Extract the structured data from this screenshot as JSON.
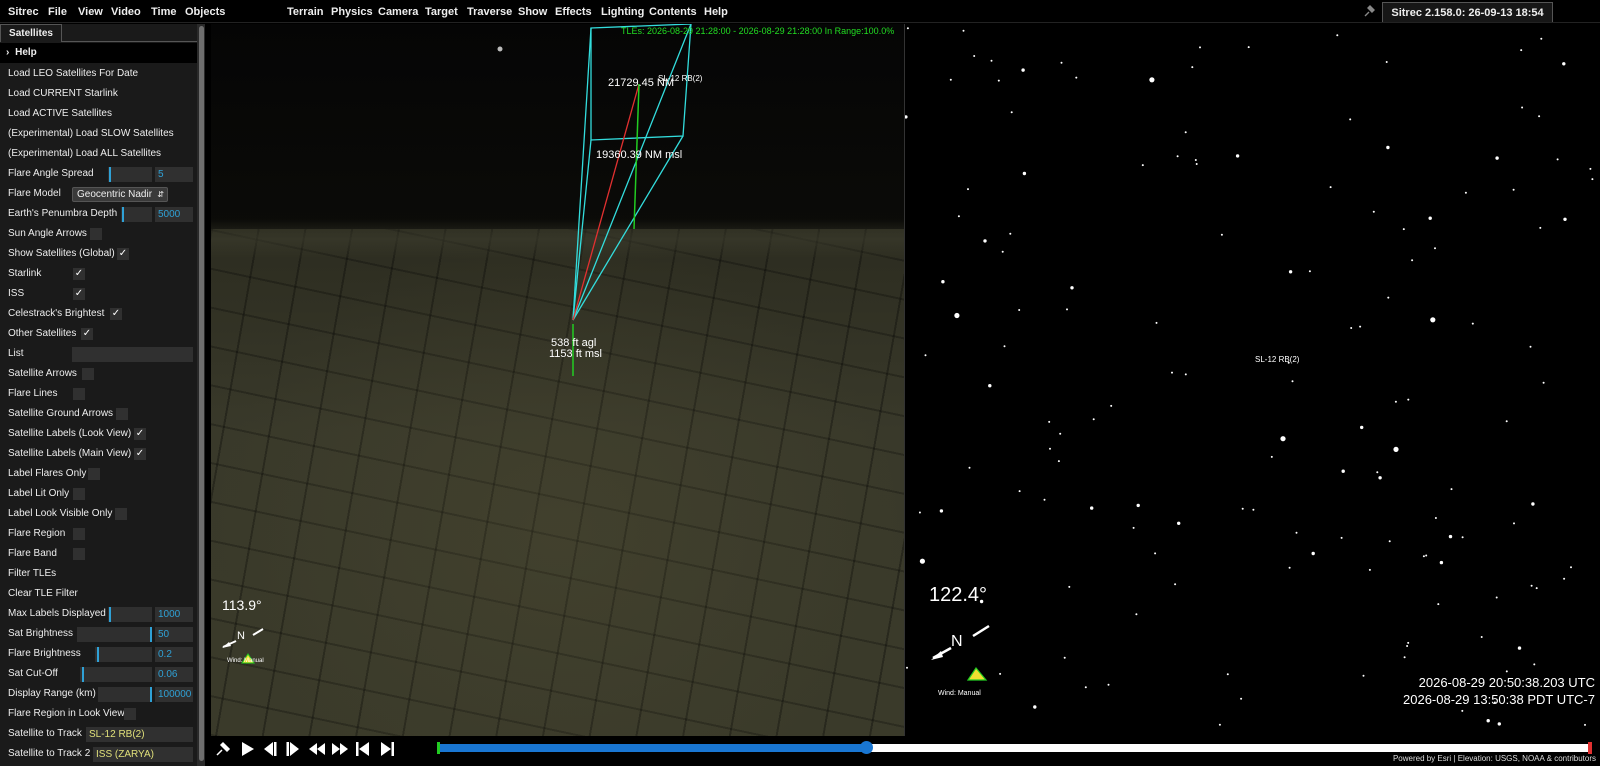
{
  "menubar": {
    "left_items": [
      "Sitrec",
      "File",
      "View",
      "Video",
      "Time",
      "Objects"
    ],
    "right_items": [
      "Terrain",
      "Physics",
      "Camera",
      "Target",
      "Traverse",
      "Show",
      "Effects",
      "Lighting",
      "Contents",
      "Help"
    ],
    "version": "Sitrec 2.158.0: 26-09-13 18:54 UTC"
  },
  "panel": {
    "tab": "Satellites",
    "help": "Help",
    "rows": {
      "load_leo": "Load LEO Satellites For Date",
      "load_starlink": "Load CURRENT Starlink",
      "load_active": "Load ACTIVE Satellites",
      "load_slow": "(Experimental) Load SLOW Satellites",
      "load_all": "(Experimental) Load ALL Satellites",
      "flare_angle_spread": {
        "label": "Flare Angle Spread",
        "value": "5"
      },
      "flare_model": {
        "label": "Flare Model",
        "value": "Geocentric Nadir"
      },
      "penumbra_depth": {
        "label": "Earth's Penumbra Depth",
        "value": "5000"
      },
      "sun_angle_arrows": {
        "label": "Sun Angle Arrows",
        "checked": false
      },
      "show_satellites": {
        "label": "Show Satellites (Global)",
        "checked": true
      },
      "starlink": {
        "label": "Starlink",
        "checked": true
      },
      "iss": {
        "label": "ISS",
        "checked": true
      },
      "celestrack": {
        "label": "Celestrack's Brightest",
        "checked": true
      },
      "other_sats": {
        "label": "Other Satellites",
        "checked": true
      },
      "list": {
        "label": "List",
        "value": ""
      },
      "satellite_arrows": {
        "label": "Satellite Arrows",
        "checked": false
      },
      "flare_lines": {
        "label": "Flare Lines",
        "checked": false
      },
      "ground_arrows": {
        "label": "Satellite Ground Arrows",
        "checked": false
      },
      "labels_look": {
        "label": "Satellite Labels (Look View)",
        "checked": true
      },
      "labels_main": {
        "label": "Satellite Labels (Main View)",
        "checked": true
      },
      "label_flares_only": {
        "label": "Label Flares Only",
        "checked": false
      },
      "label_lit_only": {
        "label": "Label Lit Only",
        "checked": false
      },
      "label_look_visible": {
        "label": "Label Look Visible Only",
        "checked": false
      },
      "flare_region": {
        "label": "Flare Region",
        "checked": false
      },
      "flare_band": {
        "label": "Flare Band",
        "checked": false
      },
      "filter_tles": "Filter TLEs",
      "clear_tle_filter": "Clear TLE Filter",
      "max_labels": {
        "label": "Max Labels Displayed",
        "value": "1000"
      },
      "sat_brightness": {
        "label": "Sat Brightness",
        "value": "50"
      },
      "flare_brightness": {
        "label": "Flare Brightness",
        "value": "0.2"
      },
      "sat_cutoff": {
        "label": "Sat Cut-Off",
        "value": "0.06"
      },
      "display_range": {
        "label": "Display Range (km)",
        "value": "100000"
      },
      "flare_region_look": {
        "label": "Flare Region in Look View",
        "checked": false
      },
      "sat_to_track": {
        "label": "Satellite to Track",
        "value": "SL-12 RB(2)"
      },
      "sat_to_track2": {
        "label": "Satellite to Track 2",
        "value": "ISS (ZARYA)"
      }
    }
  },
  "mainview": {
    "tle_info": "TLEs: 2026-08-29 21:28:00 - 2026-08-29 21:28:00   In Range:100.0%",
    "range_nm": "21729.45 NM",
    "sat_label": "SL-12 RB(2)",
    "alt_msl": "19360.39 NM msl",
    "agl": "538 ft agl",
    "msl": "1153 ft msl",
    "heading": "113.9°",
    "north": "N",
    "wind": "Wind: Manual"
  },
  "lookview": {
    "sat_label": "SL-12 RB(2)",
    "heading": "122.4°",
    "north": "N",
    "wind": "Wind: Manual",
    "utc_time": "2026-08-29 20:50:38.203 UTC",
    "local_time": "2026-08-29 13:50:38 PDT UTC-7"
  },
  "colors": {
    "accent": "#2fa1d6",
    "tle_green": "#22dd22",
    "frustum_cyan": "#33dddd",
    "timeline_blue": "#1976d2"
  },
  "playback": {
    "icons": [
      "pin-icon",
      "play-icon",
      "step-back-icon",
      "step-forward-icon",
      "rewind-icon",
      "fast-forward-icon",
      "skip-start-icon",
      "skip-end-icon"
    ],
    "timeline_position": 0.37
  },
  "credit": "Powered by Esri | Elevation: USGS, NOAA & contributors"
}
